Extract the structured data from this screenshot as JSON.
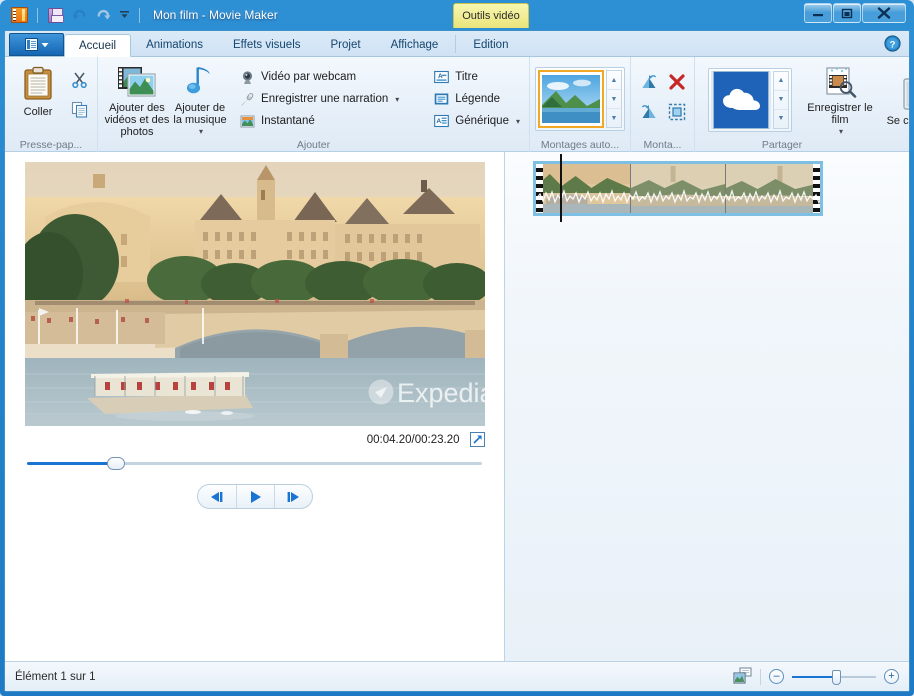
{
  "window": {
    "title": "Mon film - Movie Maker",
    "contextual_tab": "Outils vidéo",
    "minimize": "–",
    "maximize": "□",
    "close": "✕"
  },
  "quick_access": {
    "app_icon": "movie-maker-icon",
    "save_icon": "save-icon",
    "undo_icon": "undo-icon",
    "redo_icon": "redo-icon",
    "customize_icon": "chevron-down-icon"
  },
  "tabs": {
    "file_menu_label": "",
    "items": [
      {
        "label": "Accueil",
        "active": true
      },
      {
        "label": "Animations",
        "active": false
      },
      {
        "label": "Effets visuels",
        "active": false
      },
      {
        "label": "Projet",
        "active": false
      },
      {
        "label": "Affichage",
        "active": false
      },
      {
        "label": "Edition",
        "active": false,
        "contextual": true
      }
    ],
    "help_icon": "help-icon"
  },
  "ribbon": {
    "groups": [
      {
        "name": "clipboard",
        "label": "Presse-pap...",
        "paste_label": "Coller",
        "paste_icon": "paste-clipboard-icon",
        "cut_icon": "scissors-icon",
        "copy_icon": "copy-icon"
      },
      {
        "name": "add",
        "label": "Ajouter",
        "add_video_photos_label": "Ajouter des vidéos et des photos",
        "add_video_photos_icon": "film-photo-icon",
        "add_music_label": "Ajouter de la musique",
        "add_music_icon": "music-note-icon",
        "items": [
          {
            "label": "Vidéo par webcam",
            "icon": "webcam-icon",
            "has_dropdown": false
          },
          {
            "label": "Enregistrer une narration",
            "icon": "microphone-icon",
            "has_dropdown": true
          },
          {
            "label": "Instantané",
            "icon": "snapshot-icon",
            "has_dropdown": false
          },
          {
            "label": "Titre",
            "icon": "title-text-icon",
            "has_dropdown": false
          },
          {
            "label": "Légende",
            "icon": "caption-icon",
            "has_dropdown": false
          },
          {
            "label": "Générique",
            "icon": "credits-icon",
            "has_dropdown": true
          }
        ]
      },
      {
        "name": "autofilm",
        "label": "Montages auto...",
        "gallery_item_icon": "landscape-thumbnail-icon",
        "scroll_up_icon": "scroll-up-icon",
        "scroll_down_icon": "scroll-down-icon",
        "more_icon": "gallery-more-icon"
      },
      {
        "name": "editing",
        "label": "Monta...",
        "tools": [
          {
            "icon": "rotate-left-icon"
          },
          {
            "icon": "delete-red-x-icon"
          },
          {
            "icon": "rotate-right-icon"
          },
          {
            "icon": "select-all-icon"
          }
        ]
      },
      {
        "name": "share",
        "label": "Partager",
        "onedrive_icon": "onedrive-cloud-icon",
        "scroll_up_icon": "scroll-up-icon",
        "scroll_down_icon": "scroll-down-icon",
        "more_icon": "gallery-more-icon",
        "save_movie_label": "Enregistrer le film",
        "save_movie_icon": "save-movie-icon",
        "sign_in_label": "Se connecter",
        "sign_in_icon": "user-account-icon"
      }
    ]
  },
  "preview": {
    "timecode": "00:04.20/00:23.20",
    "fullscreen_icon": "fullscreen-arrow-icon",
    "seek_position_percent": 18,
    "transport": {
      "previous_frame_icon": "previous-frame-icon",
      "play_icon": "play-icon",
      "next_frame_icon": "next-frame-icon"
    },
    "watermark": "Expedia"
  },
  "storyboard": {
    "clip_count": 3,
    "playhead_position_percent": 18,
    "selection_color": "#7ec0e4"
  },
  "status": {
    "item_count_label": "Élément 1 sur 1",
    "view_toggle_icon": "storyboard-view-icon",
    "zoom_out_label": "–",
    "zoom_in_label": "+",
    "zoom_percent": 50
  },
  "colors": {
    "accent": "#1a75d2",
    "frame": "#2484cc",
    "contextual_yellow": "#e8e47a",
    "gallery_highlight": "#f0a825"
  }
}
